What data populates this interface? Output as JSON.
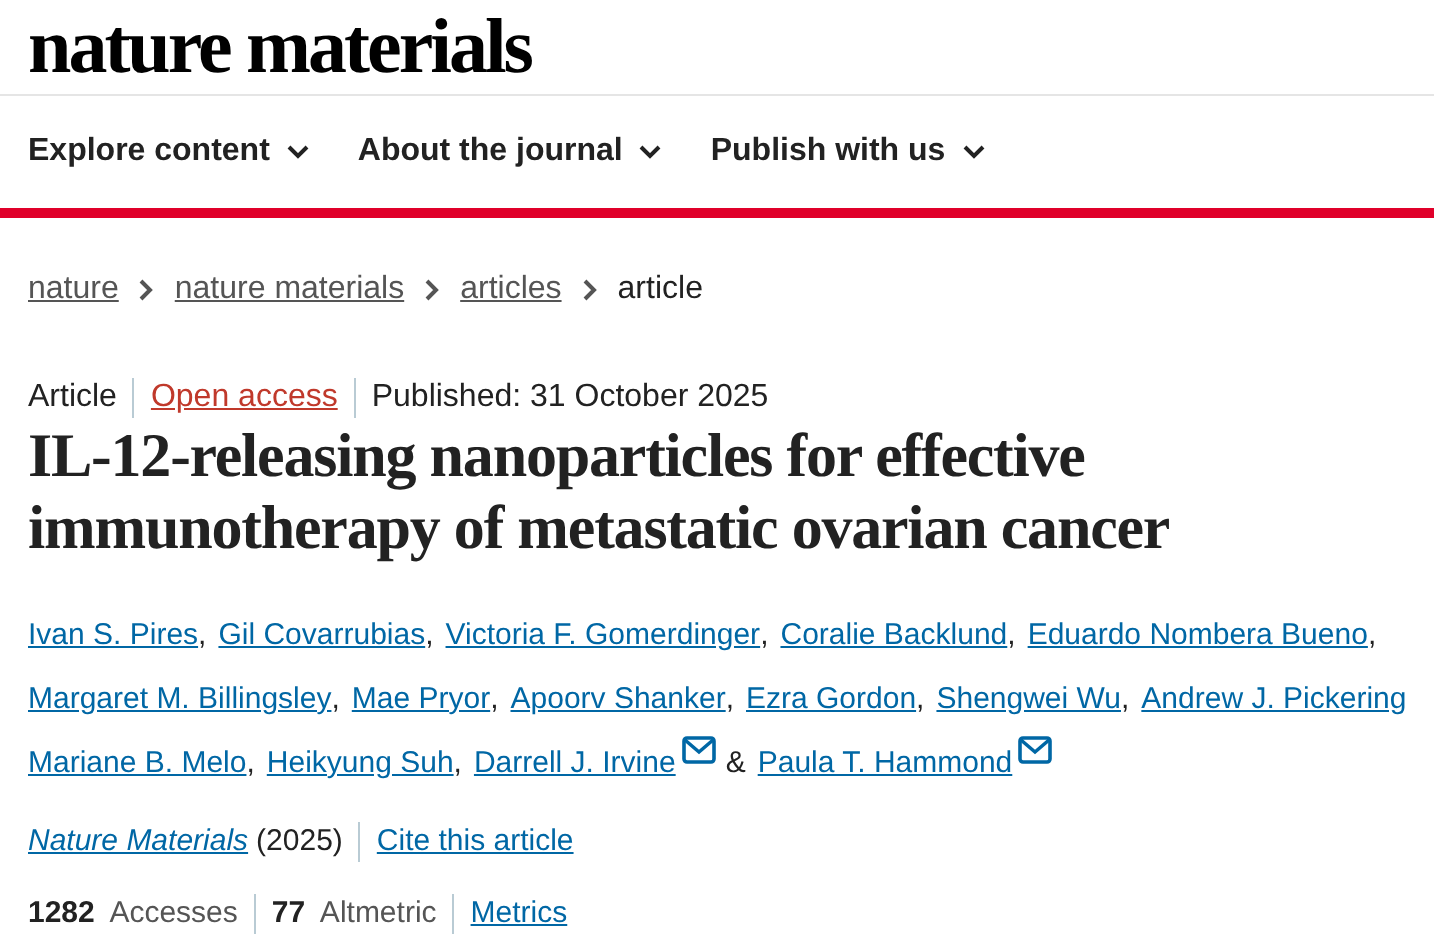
{
  "logo": "nature materials",
  "nav": [
    {
      "label": "Explore content"
    },
    {
      "label": "About the journal"
    },
    {
      "label": "Publish with us"
    }
  ],
  "breadcrumbs": [
    {
      "label": "nature",
      "kind": "link"
    },
    {
      "label": "nature materials",
      "kind": "link"
    },
    {
      "label": "articles",
      "kind": "link"
    },
    {
      "label": "article",
      "kind": "current"
    }
  ],
  "meta": {
    "type": "Article",
    "access": "Open access",
    "published": "Published: 31 October 2025"
  },
  "title": "IL-12-releasing nanoparticles for effective immunotherapy of metastatic ovarian cancer",
  "authors": [
    {
      "name": "Ivan S. Pires",
      "email": false,
      "after": ","
    },
    {
      "name": "Gil Covarrubias",
      "email": false,
      "after": ","
    },
    {
      "name": "Victoria F. Gomerdinger",
      "email": false,
      "after": ","
    },
    {
      "name": "Coralie Backlund",
      "email": false,
      "after": ","
    },
    {
      "name": "Eduardo Nombera Bueno",
      "email": false,
      "after": ","
    },
    {
      "name": "Margaret M. Billingsley",
      "email": false,
      "after": ","
    },
    {
      "name": "Mae Pryor",
      "email": false,
      "after": ","
    },
    {
      "name": "Apoorv Shanker",
      "email": false,
      "after": ","
    },
    {
      "name": "Ezra Gordon",
      "email": false,
      "after": ","
    },
    {
      "name": "Shengwei Wu",
      "email": false,
      "after": ","
    },
    {
      "name": "Andrew J. Pickering",
      "email": false
    },
    {
      "name": "Mariane B. Melo",
      "email": false,
      "after": ","
    },
    {
      "name": "Heikyung Suh",
      "email": false,
      "after": ","
    },
    {
      "name": "Darrell J. Irvine",
      "email": true,
      "after": "&"
    },
    {
      "name": "Paula T. Hammond",
      "email": true
    }
  ],
  "citation": {
    "journal": "Nature Materials",
    "year": "(2025)",
    "cite": "Cite this article"
  },
  "metrics": [
    "**1282** Accesses",
    "**77** Altmetric"
  ],
  "metrics_link": "Metrics"
}
